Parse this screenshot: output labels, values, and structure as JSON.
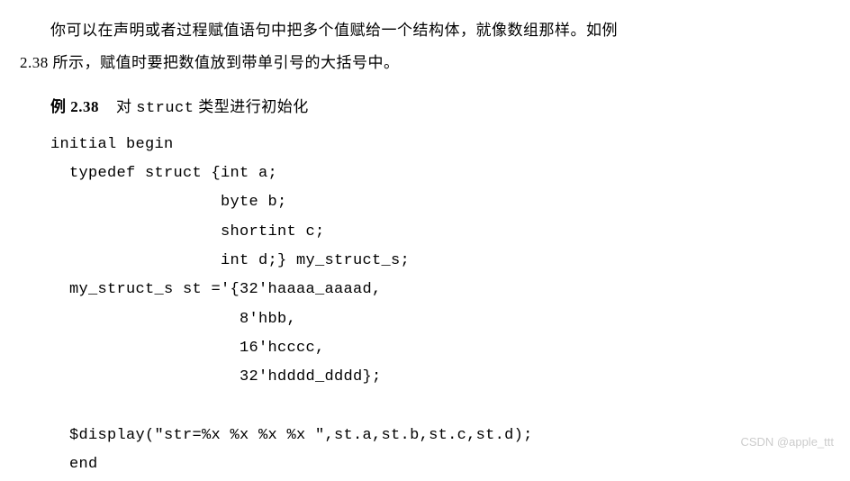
{
  "paragraph_line1": "你可以在声明或者过程赋值语句中把多个值赋给一个结构体，就像数组那样。如例",
  "paragraph_line2": "2.38 所示，赋值时要把数值放到带单引号的大括号中。",
  "example_label_bold": "例 2.38",
  "example_label_rest_prefix": "对 ",
  "example_label_mono": "struct",
  "example_label_rest_suffix": " 类型进行初始化",
  "code": "initial begin\n  typedef struct {int a;\n                  byte b;\n                  shortint c;\n                  int d;} my_struct_s;\n  my_struct_s st ='{32'haaaa_aaaad,\n                    8'hbb,\n                    16'hcccc,\n                    32'hdddd_dddd};\n\n  $display(\"str=%x %x %x %x \",st.a,st.b,st.c,st.d);\n  end",
  "watermark": "CSDN @apple_ttt"
}
